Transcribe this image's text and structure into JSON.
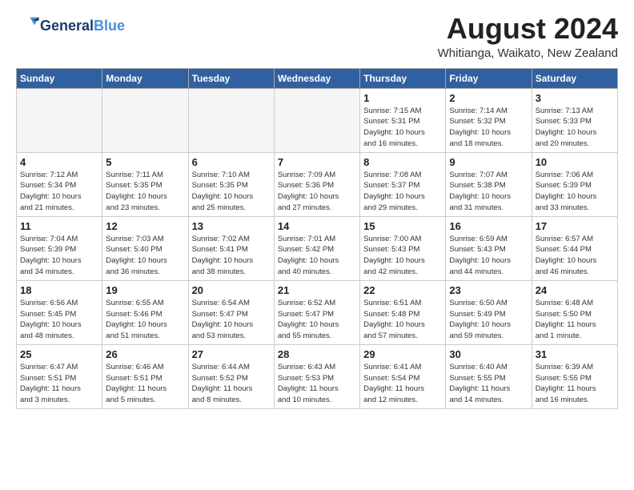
{
  "logo": {
    "line1": "General",
    "line2": "Blue"
  },
  "title": "August 2024",
  "location": "Whitianga, Waikato, New Zealand",
  "days_of_week": [
    "Sunday",
    "Monday",
    "Tuesday",
    "Wednesday",
    "Thursday",
    "Friday",
    "Saturday"
  ],
  "weeks": [
    [
      {
        "day": "",
        "info": ""
      },
      {
        "day": "",
        "info": ""
      },
      {
        "day": "",
        "info": ""
      },
      {
        "day": "",
        "info": ""
      },
      {
        "day": "1",
        "info": "Sunrise: 7:15 AM\nSunset: 5:31 PM\nDaylight: 10 hours\nand 16 minutes."
      },
      {
        "day": "2",
        "info": "Sunrise: 7:14 AM\nSunset: 5:32 PM\nDaylight: 10 hours\nand 18 minutes."
      },
      {
        "day": "3",
        "info": "Sunrise: 7:13 AM\nSunset: 5:33 PM\nDaylight: 10 hours\nand 20 minutes."
      }
    ],
    [
      {
        "day": "4",
        "info": "Sunrise: 7:12 AM\nSunset: 5:34 PM\nDaylight: 10 hours\nand 21 minutes."
      },
      {
        "day": "5",
        "info": "Sunrise: 7:11 AM\nSunset: 5:35 PM\nDaylight: 10 hours\nand 23 minutes."
      },
      {
        "day": "6",
        "info": "Sunrise: 7:10 AM\nSunset: 5:35 PM\nDaylight: 10 hours\nand 25 minutes."
      },
      {
        "day": "7",
        "info": "Sunrise: 7:09 AM\nSunset: 5:36 PM\nDaylight: 10 hours\nand 27 minutes."
      },
      {
        "day": "8",
        "info": "Sunrise: 7:08 AM\nSunset: 5:37 PM\nDaylight: 10 hours\nand 29 minutes."
      },
      {
        "day": "9",
        "info": "Sunrise: 7:07 AM\nSunset: 5:38 PM\nDaylight: 10 hours\nand 31 minutes."
      },
      {
        "day": "10",
        "info": "Sunrise: 7:06 AM\nSunset: 5:39 PM\nDaylight: 10 hours\nand 33 minutes."
      }
    ],
    [
      {
        "day": "11",
        "info": "Sunrise: 7:04 AM\nSunset: 5:39 PM\nDaylight: 10 hours\nand 34 minutes."
      },
      {
        "day": "12",
        "info": "Sunrise: 7:03 AM\nSunset: 5:40 PM\nDaylight: 10 hours\nand 36 minutes."
      },
      {
        "day": "13",
        "info": "Sunrise: 7:02 AM\nSunset: 5:41 PM\nDaylight: 10 hours\nand 38 minutes."
      },
      {
        "day": "14",
        "info": "Sunrise: 7:01 AM\nSunset: 5:42 PM\nDaylight: 10 hours\nand 40 minutes."
      },
      {
        "day": "15",
        "info": "Sunrise: 7:00 AM\nSunset: 5:43 PM\nDaylight: 10 hours\nand 42 minutes."
      },
      {
        "day": "16",
        "info": "Sunrise: 6:59 AM\nSunset: 5:43 PM\nDaylight: 10 hours\nand 44 minutes."
      },
      {
        "day": "17",
        "info": "Sunrise: 6:57 AM\nSunset: 5:44 PM\nDaylight: 10 hours\nand 46 minutes."
      }
    ],
    [
      {
        "day": "18",
        "info": "Sunrise: 6:56 AM\nSunset: 5:45 PM\nDaylight: 10 hours\nand 48 minutes."
      },
      {
        "day": "19",
        "info": "Sunrise: 6:55 AM\nSunset: 5:46 PM\nDaylight: 10 hours\nand 51 minutes."
      },
      {
        "day": "20",
        "info": "Sunrise: 6:54 AM\nSunset: 5:47 PM\nDaylight: 10 hours\nand 53 minutes."
      },
      {
        "day": "21",
        "info": "Sunrise: 6:52 AM\nSunset: 5:47 PM\nDaylight: 10 hours\nand 55 minutes."
      },
      {
        "day": "22",
        "info": "Sunrise: 6:51 AM\nSunset: 5:48 PM\nDaylight: 10 hours\nand 57 minutes."
      },
      {
        "day": "23",
        "info": "Sunrise: 6:50 AM\nSunset: 5:49 PM\nDaylight: 10 hours\nand 59 minutes."
      },
      {
        "day": "24",
        "info": "Sunrise: 6:48 AM\nSunset: 5:50 PM\nDaylight: 11 hours\nand 1 minute."
      }
    ],
    [
      {
        "day": "25",
        "info": "Sunrise: 6:47 AM\nSunset: 5:51 PM\nDaylight: 11 hours\nand 3 minutes."
      },
      {
        "day": "26",
        "info": "Sunrise: 6:46 AM\nSunset: 5:51 PM\nDaylight: 11 hours\nand 5 minutes."
      },
      {
        "day": "27",
        "info": "Sunrise: 6:44 AM\nSunset: 5:52 PM\nDaylight: 11 hours\nand 8 minutes."
      },
      {
        "day": "28",
        "info": "Sunrise: 6:43 AM\nSunset: 5:53 PM\nDaylight: 11 hours\nand 10 minutes."
      },
      {
        "day": "29",
        "info": "Sunrise: 6:41 AM\nSunset: 5:54 PM\nDaylight: 11 hours\nand 12 minutes."
      },
      {
        "day": "30",
        "info": "Sunrise: 6:40 AM\nSunset: 5:55 PM\nDaylight: 11 hours\nand 14 minutes."
      },
      {
        "day": "31",
        "info": "Sunrise: 6:39 AM\nSunset: 5:55 PM\nDaylight: 11 hours\nand 16 minutes."
      }
    ]
  ]
}
